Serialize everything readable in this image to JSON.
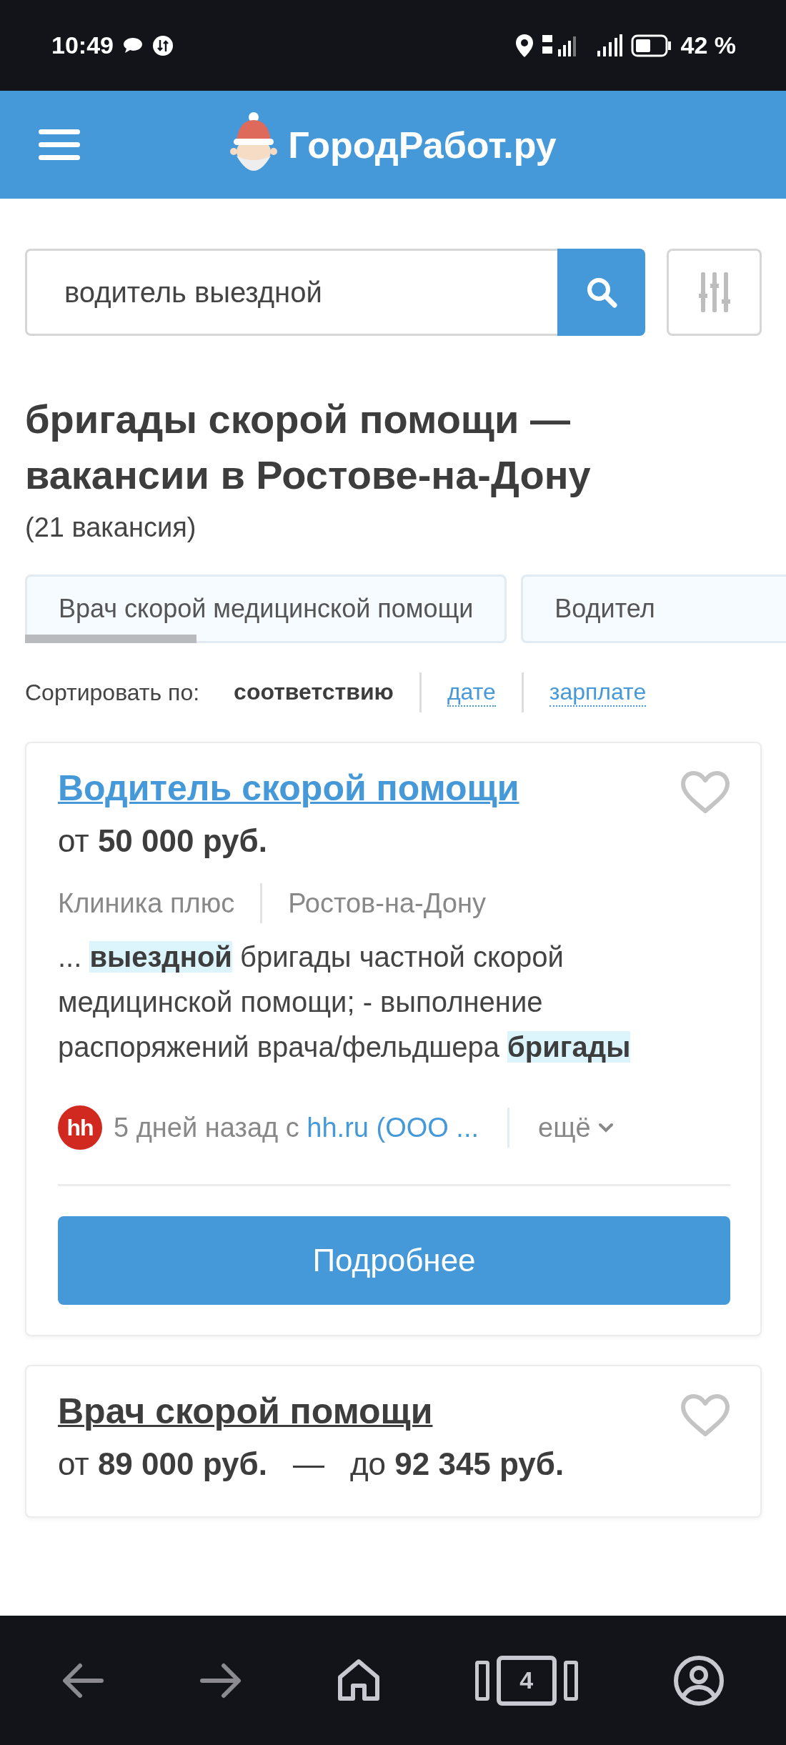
{
  "status_bar": {
    "time": "10:49",
    "battery": "42 %"
  },
  "header": {
    "logo": "ГородРабот.ру"
  },
  "search": {
    "value": "водитель выездной"
  },
  "heading": {
    "title": "бригады скорой помощи — вакансии в Ростове-на-Дону",
    "count": "(21 вакансия)"
  },
  "chips": [
    {
      "label": "Врач скорой медицинской помощи"
    },
    {
      "label": "Водител"
    }
  ],
  "sort": {
    "label": "Сортировать по:",
    "options": [
      {
        "label": "соответствию",
        "selected": true
      },
      {
        "label": "дате",
        "selected": false
      },
      {
        "label": "зарплате",
        "selected": false
      }
    ]
  },
  "vacancies": [
    {
      "title": "Водитель скорой помощи",
      "visited": false,
      "salary": [
        "от **50 000 руб.**"
      ],
      "company": "Клиника плюс",
      "city": "Ростов-на-Дону",
      "snippet": "... **выездной** бригады частной скорой медицинской помощи; - выполнение распоряжений врача/фельдшера **бригады**",
      "source_logo": "hh",
      "source_prefix": "5 дней назад с",
      "source_link": "hh.ru (ООО ...",
      "more": "ещё",
      "button": "Подробнее"
    },
    {
      "title": "Врач скорой помощи",
      "visited": true,
      "salary": [
        "от **89 000 руб.**",
        "—",
        "до **92 345 руб.**"
      ]
    }
  ],
  "nav": {
    "tabs_count": "4"
  }
}
